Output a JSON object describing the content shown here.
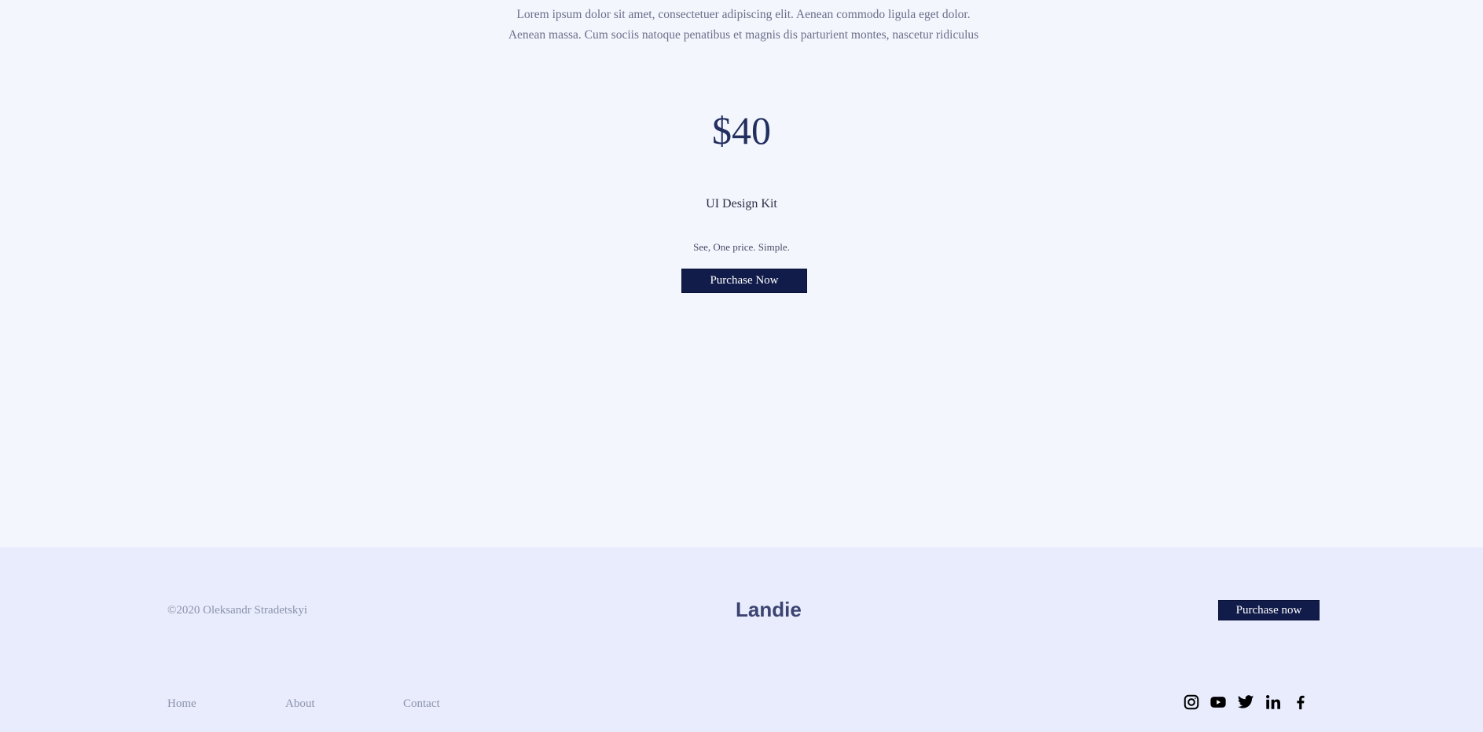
{
  "pricing": {
    "description": "Lorem ipsum dolor sit amet, consectetuer adipiscing elit. Aenean commodo ligula eget dolor. Aenean massa. Cum sociis natoque penatibus et magnis dis parturient montes, nascetur ridiculus",
    "price": "$40",
    "product_name": "UI Design Kit",
    "tagline": "See, One price. Simple.",
    "cta_label": "Purchase Now"
  },
  "footer": {
    "copyright": "©2020 Oleksandr Stradetskyi",
    "brand": "Landie",
    "cta_label": "Purchase now",
    "nav": [
      {
        "label": "Home"
      },
      {
        "label": "About"
      },
      {
        "label": "Contact"
      }
    ],
    "social_icons": [
      "instagram-icon",
      "youtube-icon",
      "twitter-icon",
      "linkedin-icon",
      "facebook-icon"
    ]
  },
  "colors": {
    "page_bg": "#f3f6fd",
    "footer_bg": "#e8ecfc",
    "primary_button": "#111c4b",
    "price_text": "#23305f",
    "brand_text": "#3b4470",
    "muted_text": "#8d93ad"
  }
}
